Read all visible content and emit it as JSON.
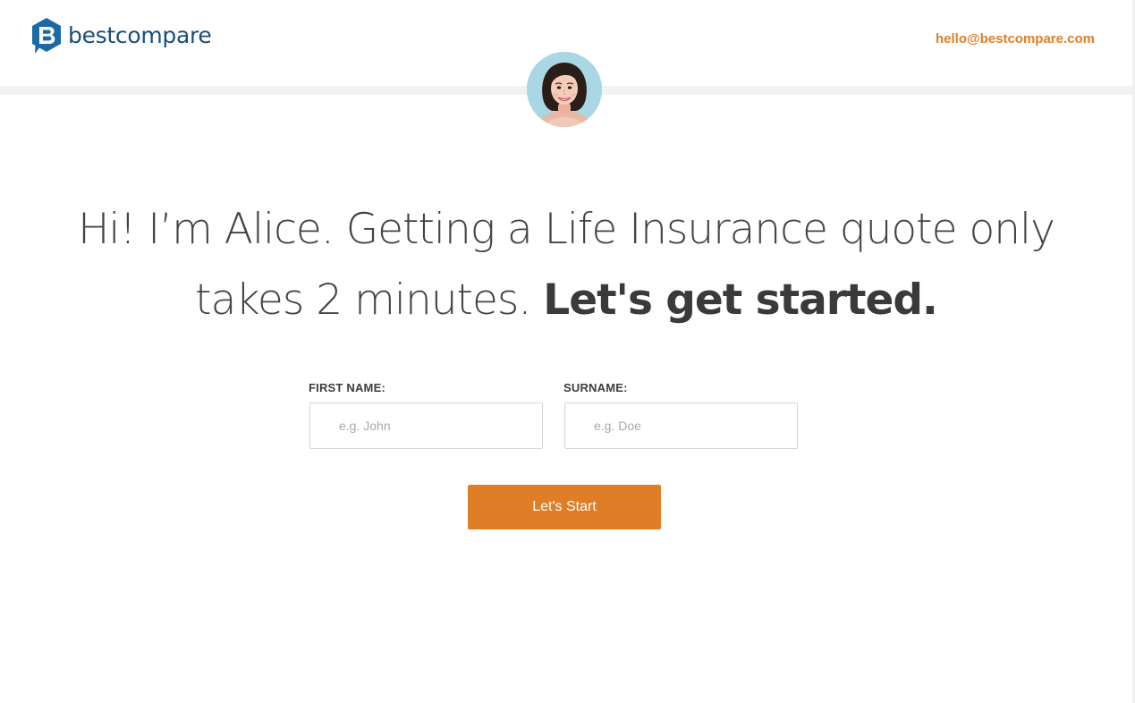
{
  "header": {
    "logo_text": "bestcompare",
    "contact_email": "hello@bestcompare.com"
  },
  "assistant": {
    "avatar_icon": "woman-portrait-avatar"
  },
  "headline": {
    "lead": "Hi! I’m Alice. Getting a Life Insurance quote only takes 2 minutes.",
    "emphasis": "Let's get started."
  },
  "form": {
    "first_name": {
      "label": "FIRST NAME:",
      "placeholder": "e.g. John",
      "value": ""
    },
    "surname": {
      "label": "SURNAME:",
      "placeholder": "e.g. Doe",
      "value": ""
    },
    "submit_label": "Let's Start"
  },
  "colors": {
    "brand_blue": "#1b6aa5",
    "logo_text": "#1b4e7a",
    "accent_orange": "#e07e27",
    "headline_text": "#3a3a3a",
    "input_border": "#d6d6d6"
  }
}
